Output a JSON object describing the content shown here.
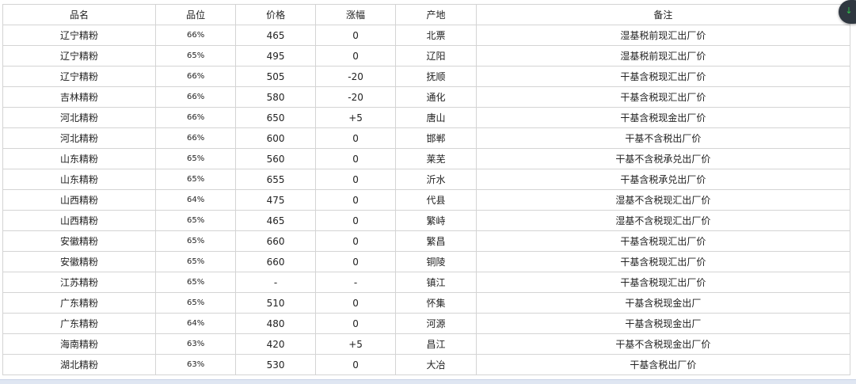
{
  "table": {
    "headers": [
      "品名",
      "品位",
      "价格",
      "涨幅",
      "产地",
      "备注"
    ],
    "rows": [
      [
        "辽宁精粉",
        "66%",
        "465",
        "0",
        "北票",
        "湿基税前现汇出厂价"
      ],
      [
        "辽宁精粉",
        "65%",
        "495",
        "0",
        "辽阳",
        "湿基税前现汇出厂价"
      ],
      [
        "辽宁精粉",
        "66%",
        "505",
        "-20",
        "抚顺",
        "干基含税现汇出厂价"
      ],
      [
        "吉林精粉",
        "66%",
        "580",
        "-20",
        "通化",
        "干基含税现汇出厂价"
      ],
      [
        "河北精粉",
        "66%",
        "650",
        "+5",
        "唐山",
        "干基含税现金出厂价"
      ],
      [
        "河北精粉",
        "66%",
        "600",
        "0",
        "邯郸",
        "干基不含税出厂价"
      ],
      [
        "山东精粉",
        "65%",
        "560",
        "0",
        "莱芜",
        "干基不含税承兑出厂价"
      ],
      [
        "山东精粉",
        "65%",
        "655",
        "0",
        "沂水",
        "干基含税承兑出厂价"
      ],
      [
        "山西精粉",
        "64%",
        "475",
        "0",
        "代县",
        "湿基不含税现汇出厂价"
      ],
      [
        "山西精粉",
        "65%",
        "465",
        "0",
        "繁峙",
        "湿基不含税现汇出厂价"
      ],
      [
        "安徽精粉",
        "65%",
        "660",
        "0",
        "繁昌",
        "干基含税现汇出厂价"
      ],
      [
        "安徽精粉",
        "65%",
        "660",
        "0",
        "铜陵",
        "干基含税现汇出厂价"
      ],
      [
        "江苏精粉",
        "65%",
        "-",
        "-",
        "镇江",
        "干基含税现汇出厂价"
      ],
      [
        "广东精粉",
        "65%",
        "510",
        "0",
        "怀集",
        "干基含税现金出厂"
      ],
      [
        "广东精粉",
        "64%",
        "480",
        "0",
        "河源",
        "干基含税现金出厂"
      ],
      [
        "海南精粉",
        "63%",
        "420",
        "+5",
        "昌江",
        "干基不含税现金出厂价"
      ],
      [
        "湖北精粉",
        "63%",
        "530",
        "0",
        "大冶",
        "干基含税出厂价"
      ]
    ]
  },
  "float_button": {
    "icon": "down-arrow-icon",
    "glyph": "↓",
    "accent": "#2ec24a"
  }
}
